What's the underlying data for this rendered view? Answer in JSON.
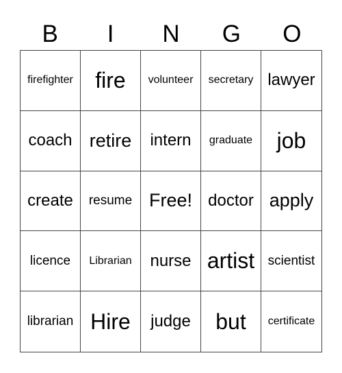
{
  "header": [
    "B",
    "I",
    "N",
    "G",
    "O"
  ],
  "cells": [
    "firefighter",
    "fire",
    "volunteer",
    "secretary",
    "lawyer",
    "coach",
    "retire",
    "intern",
    "graduate",
    "job",
    "create",
    "resume",
    "Free!",
    "doctor",
    "apply",
    "licence",
    "Librarian",
    "nurse",
    "artist",
    "scientist",
    "librarian",
    "Hire",
    "judge",
    "but",
    "certificate"
  ]
}
